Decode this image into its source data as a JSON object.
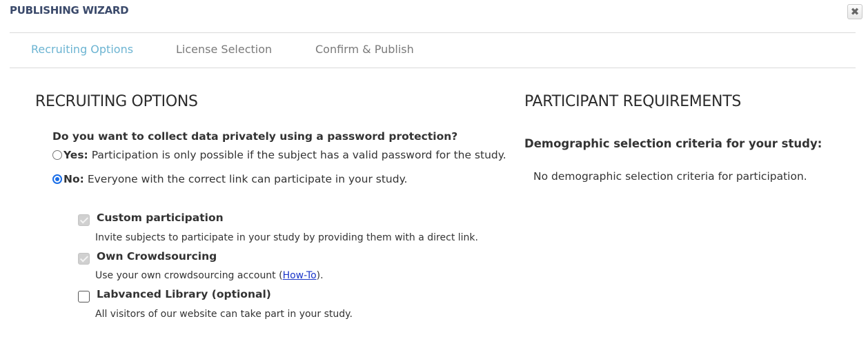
{
  "dialog": {
    "title": "PUBLISHING WIZARD",
    "close_icon": "close-icon"
  },
  "tabs": [
    {
      "label": "Recruiting Options",
      "active": true
    },
    {
      "label": "License Selection",
      "active": false
    },
    {
      "label": "Confirm & Publish",
      "active": false
    }
  ],
  "recruiting": {
    "heading": "RECRUITING OPTIONS",
    "question": "Do you want to collect data privately using a password protection?",
    "yes": {
      "label": "Yes:",
      "description": "Participation is only possible if the subject has a valid password for the study.",
      "selected": false
    },
    "no": {
      "label": "No:",
      "description": "Everyone with the correct link can participate in your study.",
      "selected": true
    },
    "options": [
      {
        "title": "Custom participation",
        "description": "Invite subjects to participate in your study by providing them with a direct link.",
        "checked": true,
        "disabled": true
      },
      {
        "title": "Own Crowdsourcing",
        "description_before": "Use your own crowdsourcing account (",
        "link": "How-To",
        "description_after": ").",
        "checked": true,
        "disabled": true
      },
      {
        "title": "Labvanced Library (optional)",
        "description": "All visitors of our website can take part in your study.",
        "checked": false,
        "disabled": false
      }
    ]
  },
  "requirements": {
    "heading": "PARTICIPANT REQUIREMENTS",
    "demographic_title": "Demographic selection criteria for your study:",
    "demographic_text": "No demographic selection criteria for participation."
  },
  "colors": {
    "accent_tab": "#6cb4d2",
    "title": "#3b4a6b",
    "radio_selected": "#1a6ee8",
    "link": "#1a35c8"
  }
}
